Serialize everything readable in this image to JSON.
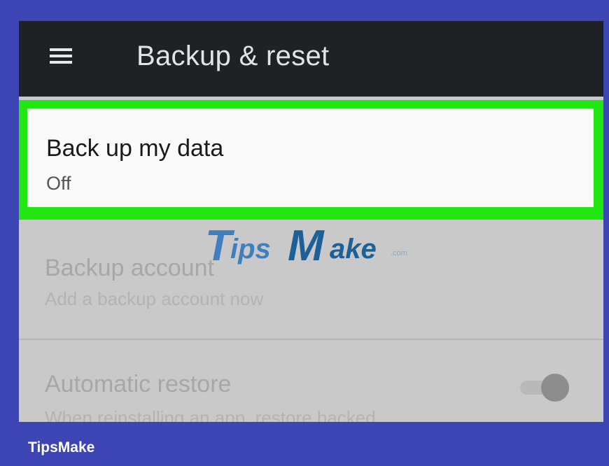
{
  "app_bar": {
    "menu_icon": "hamburger-menu-icon",
    "title": "Backup & reset"
  },
  "settings": {
    "items": [
      {
        "title": "Back up my data",
        "subtitle": "Off",
        "highlighted": true
      },
      {
        "title": "Backup account",
        "subtitle": "Add a backup account now"
      },
      {
        "title": "Automatic restore",
        "subtitle": "When reinstalling an app, restore backed",
        "toggle": "on"
      }
    ]
  },
  "watermark": {
    "t": "T",
    "ips": "ips",
    "m": "M",
    "ake": "ake",
    "com": ".com"
  },
  "footer": {
    "brand": "TipsMake"
  },
  "colors": {
    "frame": "#3d45b4",
    "app_bar": "#1e2225",
    "highlight": "#22e612",
    "dimmed_background": "#c9c9c9"
  }
}
